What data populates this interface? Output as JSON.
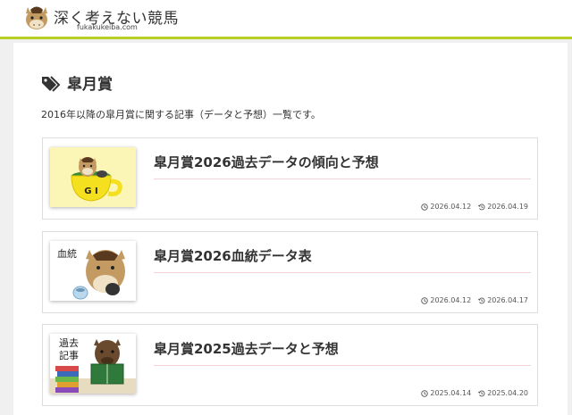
{
  "site": {
    "title": "深く考えない競馬",
    "url": "fukakukeiba.com"
  },
  "page": {
    "title": "皐月賞",
    "description": "2016年以降の皐月賞に関する記事（データと予想）一覧です。"
  },
  "articles": [
    {
      "title": "皐月賞2026過去データの傾向と予想",
      "thumb_text": "G I",
      "published": "2026.04.12",
      "updated": "2026.04.19"
    },
    {
      "title": "皐月賞2026血統データ表",
      "thumb_text": "血統",
      "published": "2026.04.12",
      "updated": "2026.04.17"
    },
    {
      "title": "皐月賞2025過去データと予想",
      "thumb_text": "過去\n記事",
      "thumb_text_line1": "過去",
      "thumb_text_line2": "記事",
      "published": "2025.04.14",
      "updated": "2025.04.20"
    }
  ],
  "icons": {
    "page": "tag-icon",
    "published": "clock-icon",
    "updated": "history-icon"
  },
  "colors": {
    "accent": "#b9cf25",
    "rule": "#f3d2d8"
  }
}
